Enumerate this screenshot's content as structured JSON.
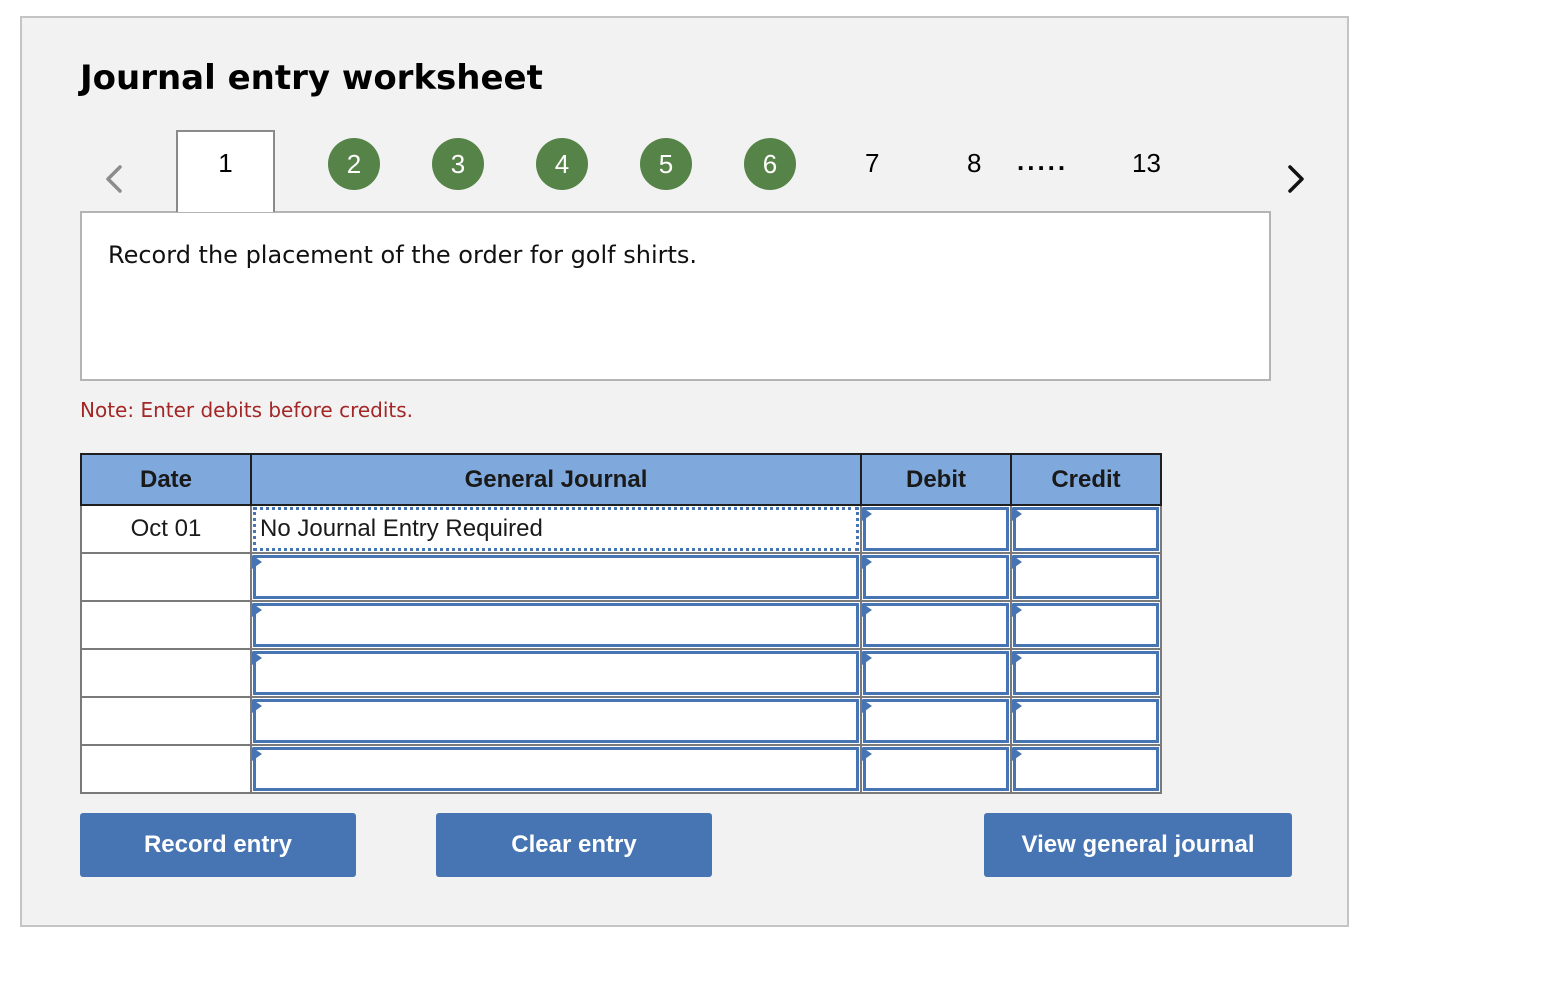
{
  "header": {
    "title": "Journal entry worksheet"
  },
  "pager": {
    "prev_icon": "chevron-left-icon",
    "next_icon": "chevron-right-icon",
    "active_step": "1",
    "completed_steps": [
      "2",
      "3",
      "4",
      "5",
      "6"
    ],
    "remaining_steps": [
      "7",
      "8"
    ],
    "ellipsis": ".....",
    "last_step": "13",
    "completed_color": "#568348"
  },
  "question": {
    "text": "Record the placement of the order for golf shirts."
  },
  "note": {
    "text": "Note: Enter debits before credits.",
    "color": "#a32727"
  },
  "table": {
    "headers": {
      "date": "Date",
      "general_journal": "General Journal",
      "debit": "Debit",
      "credit": "Credit"
    },
    "header_color": "#7fa8dc",
    "rows": [
      {
        "date": "Oct 01",
        "account": "No Journal Entry Required",
        "debit": "",
        "credit": ""
      },
      {
        "date": "",
        "account": "",
        "debit": "",
        "credit": ""
      },
      {
        "date": "",
        "account": "",
        "debit": "",
        "credit": ""
      },
      {
        "date": "",
        "account": "",
        "debit": "",
        "credit": ""
      },
      {
        "date": "",
        "account": "",
        "debit": "",
        "credit": ""
      },
      {
        "date": "",
        "account": "",
        "debit": "",
        "credit": ""
      }
    ]
  },
  "buttons": {
    "record": "Record entry",
    "clear": "Clear entry",
    "view": "View general journal",
    "color": "#4774b3"
  }
}
